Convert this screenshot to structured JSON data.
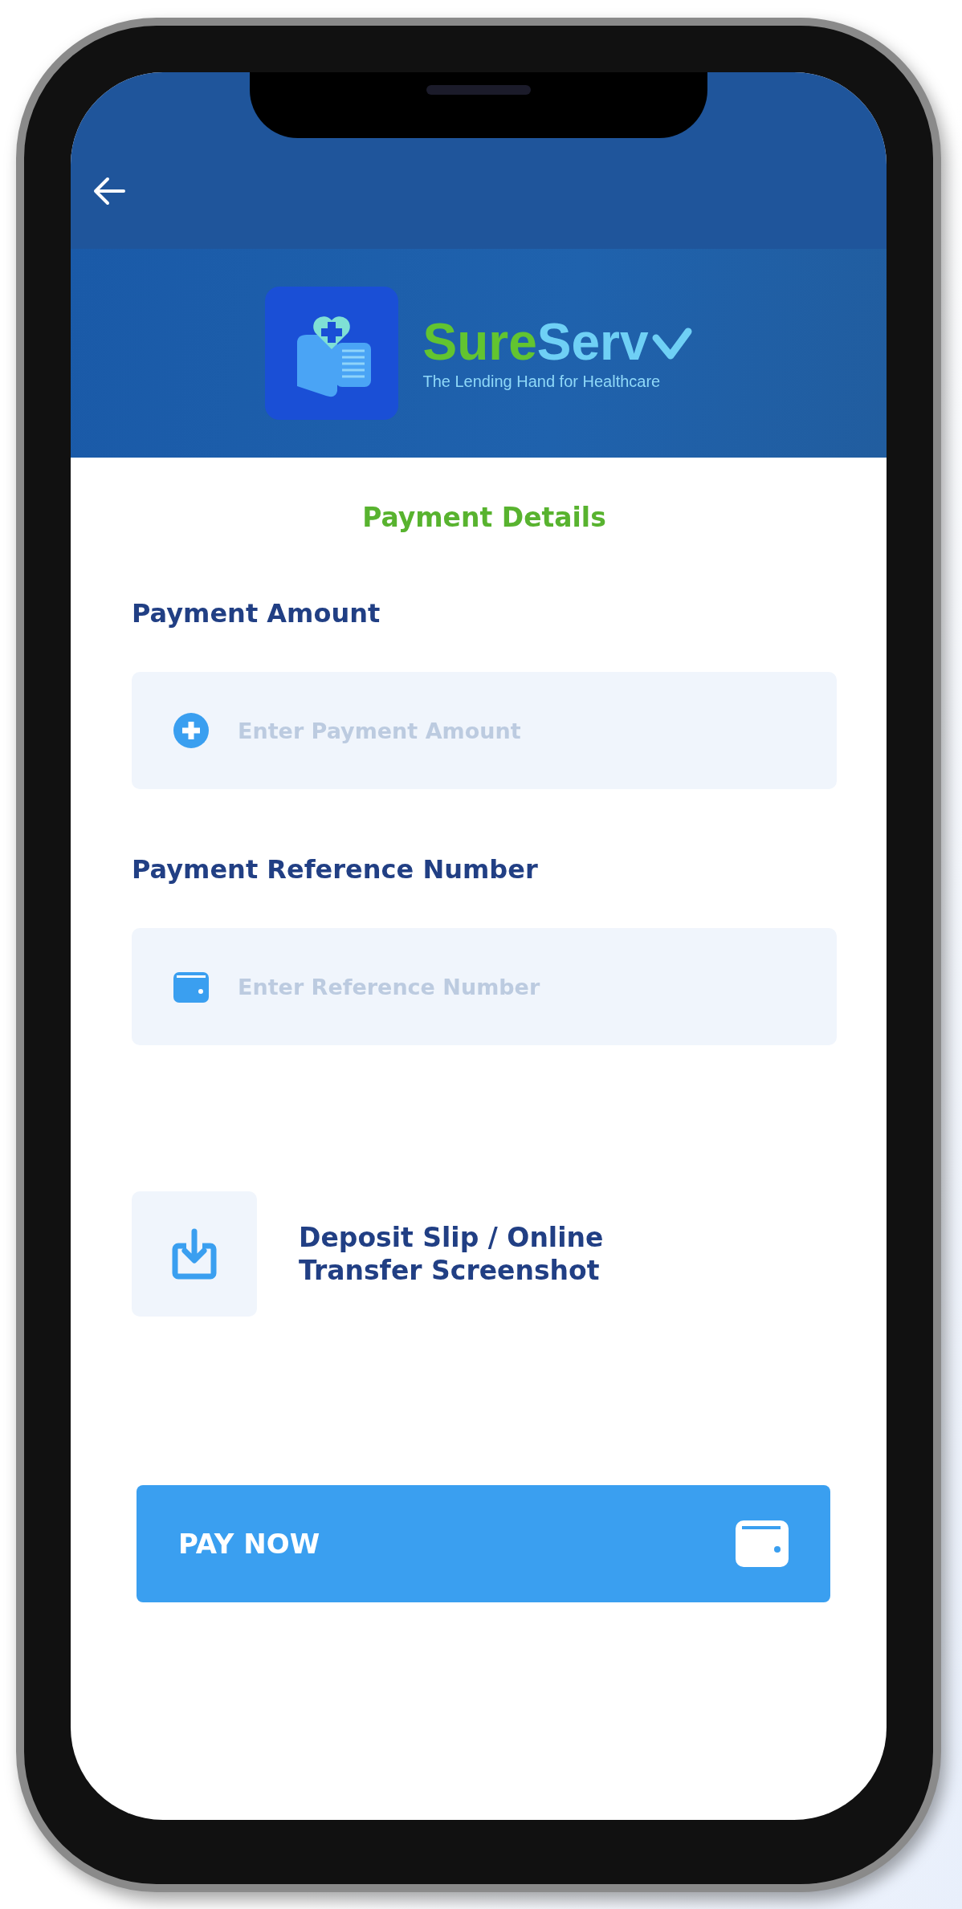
{
  "brand": {
    "name_part_1": "Sure",
    "name_part_2": "Serv",
    "tagline": "The Lending Hand for Healthcare"
  },
  "title": "Payment Details",
  "fields": [
    {
      "label": "Payment Amount",
      "placeholder": "Enter Payment Amount",
      "kind": "amount"
    },
    {
      "label": "Payment Reference Number",
      "placeholder": "Enter Reference Number",
      "kind": "reference"
    }
  ],
  "upload": {
    "label": "Deposit Slip / Online Transfer Screenshot"
  },
  "pay_button": {
    "label": "PAY NOW"
  }
}
